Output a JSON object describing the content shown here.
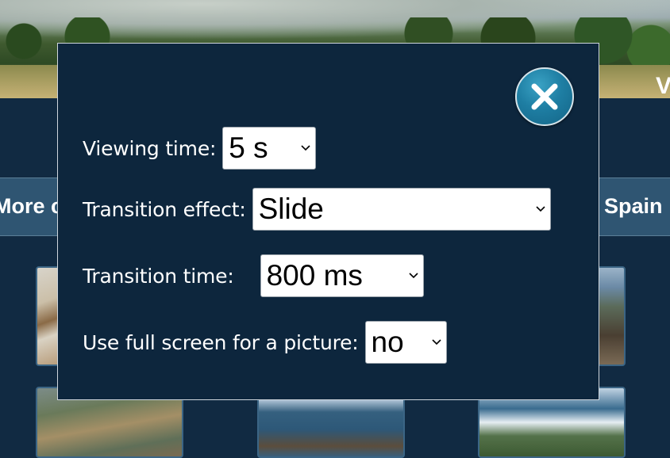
{
  "background": {
    "hero_title_fragment": "V",
    "nav_left_fragment": "More c",
    "nav_right_fragment": "Spain"
  },
  "settings_dialog": {
    "close_icon": "close-x-icon",
    "fields": [
      {
        "label": "Viewing time:",
        "value": "5 s"
      },
      {
        "label": "Transition effect:",
        "value": "Slide"
      },
      {
        "label": "Transition time:",
        "value": "800 ms"
      },
      {
        "label": "Use full screen for a picture:",
        "value": "no"
      }
    ]
  },
  "colors": {
    "dialog_background": "#0d263d",
    "page_background": "#112a42",
    "nav_bar": "#2f5572",
    "close_button": "#1e7ea3"
  }
}
